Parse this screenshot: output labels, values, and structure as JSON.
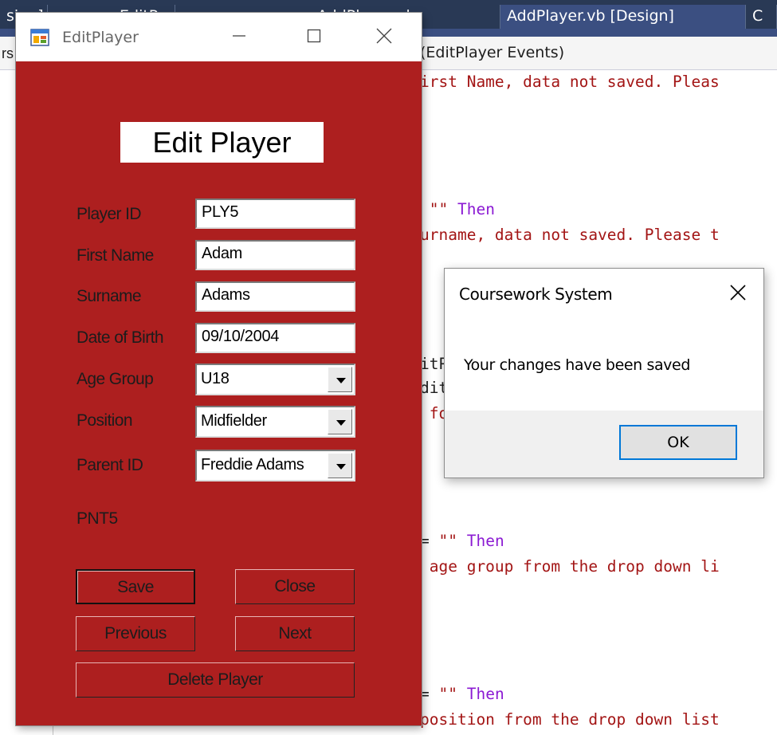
{
  "ide": {
    "tabs": [
      {
        "label": "sign]"
      },
      {
        "label": "EditParent.vb"
      },
      {
        "label": "AddPlayer.vb"
      },
      {
        "label": "AddPlayer.vb [Design]"
      },
      {
        "label": "C"
      }
    ],
    "nav_left": "rs",
    "nav_events": "(EditPlayer Events)",
    "code_lines": [
      {
        "pre": "",
        "str": "irst Name, data not saved. Pleas",
        "post": "",
        "kw": ""
      },
      {
        "pre": " ",
        "str": "\"\"",
        "post": " ",
        "kw": "Then"
      },
      {
        "pre": "",
        "str": "urname, data not saved. Please t",
        "post": "",
        "kw": ""
      },
      {
        "pre": "",
        "str": "",
        "post": "itP",
        "kw": ""
      },
      {
        "pre": "",
        "str": "",
        "post": "dit",
        "kw": ""
      },
      {
        "pre": " ",
        "str": "fo",
        "post": "",
        "kw": ""
      },
      {
        "pre": "= ",
        "str": "\"\"",
        "post": " ",
        "kw": "Then"
      },
      {
        "pre": "",
        "str": " age group from the drop down li",
        "post": "",
        "kw": ""
      },
      {
        "pre": "= ",
        "str": "\"\"",
        "post": " ",
        "kw": "Then"
      },
      {
        "pre": "",
        "str": "position from the drop down list",
        "post": "",
        "kw": ""
      }
    ]
  },
  "edit_window": {
    "title": "EditPlayer",
    "heading": "Edit Player",
    "fields": {
      "player_id": {
        "label": "Player ID",
        "value": "PLY5"
      },
      "first_name": {
        "label": "First Name",
        "value": "Adam"
      },
      "surname": {
        "label": "Surname",
        "value": "Adams"
      },
      "date_of_birth": {
        "label": "Date of Birth",
        "value": "09/10/2004"
      },
      "age_group": {
        "label": "Age Group",
        "value": "U18"
      },
      "position": {
        "label": "Position",
        "value": "Midfielder"
      },
      "parent_id": {
        "label": "Parent ID",
        "value": "Freddie Adams"
      }
    },
    "parent_id_value": "PNT5",
    "buttons": {
      "save": "Save",
      "close": "Close",
      "previous": "Previous",
      "next": "Next",
      "delete": "Delete Player"
    }
  },
  "message_box": {
    "title": "Coursework System",
    "message": "Your changes have been saved",
    "ok": "OK"
  },
  "colors": {
    "form_background": "#ad1f1f",
    "ide_tabbar": "#293955",
    "ok_button_border": "#0078d7"
  }
}
